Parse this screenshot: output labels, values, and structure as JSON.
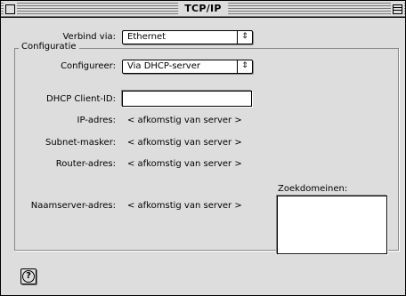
{
  "window": {
    "title": "TCP/IP"
  },
  "connect_via": {
    "label": "Verbind via:",
    "value": "Ethernet"
  },
  "configuration": {
    "group_title": "Configuratie",
    "configure_label": "Configureer:",
    "configure_value": "Via DHCP-server",
    "dhcp_client_id_label": "DHCP Client-ID:",
    "dhcp_client_id_value": "",
    "ip_address_label": "IP-adres:",
    "ip_address_value": "< afkomstig van server >",
    "subnet_mask_label": "Subnet-masker:",
    "subnet_mask_value": "< afkomstig van server >",
    "router_address_label": "Router-adres:",
    "router_address_value": "< afkomstig van server >",
    "name_server_label": "Naamserver-adres:",
    "name_server_value": "< afkomstig van server >",
    "search_domains_label": "Zoekdomeinen:",
    "search_domains_value": ""
  },
  "help": {
    "icon_glyph": "?"
  },
  "icons": {
    "popup_arrow": "up-down-arrow-icon",
    "help": "help-icon"
  }
}
